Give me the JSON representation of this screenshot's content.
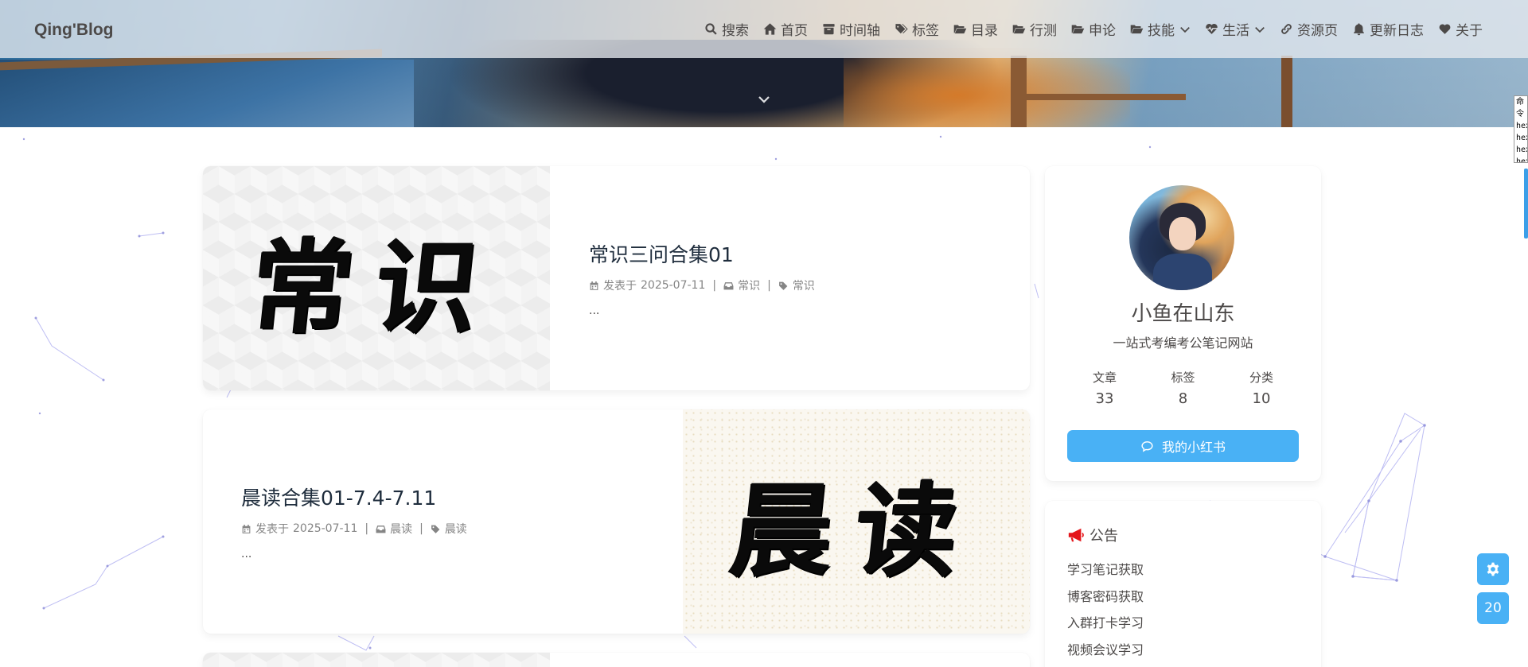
{
  "brand": "Qing'Blog",
  "nav": [
    {
      "label": "搜索",
      "icon": "search-icon"
    },
    {
      "label": "首页",
      "icon": "home-icon"
    },
    {
      "label": "时间轴",
      "icon": "archive-icon"
    },
    {
      "label": "标签",
      "icon": "tags-icon"
    },
    {
      "label": "目录",
      "icon": "folder-open-icon"
    },
    {
      "label": "行测",
      "icon": "folder-open-icon"
    },
    {
      "label": "申论",
      "icon": "folder-open-icon"
    },
    {
      "label": "技能",
      "icon": "folder-open-icon",
      "dropdown": true
    },
    {
      "label": "生活",
      "icon": "heartbeat-icon",
      "dropdown": true
    },
    {
      "label": "资源页",
      "icon": "link-icon"
    },
    {
      "label": "更新日志",
      "icon": "bell-icon"
    },
    {
      "label": "关于",
      "icon": "heart-icon"
    }
  ],
  "edge_tooltip": [
    "命令",
    "hex",
    "hex",
    "hex",
    "hex"
  ],
  "posts": [
    {
      "cover_text": "常识",
      "title": "常识三问合集01",
      "date_prefix": "发表于",
      "date": "2025-07-11",
      "category": "常识",
      "tag": "常识",
      "excerpt": "..."
    },
    {
      "cover_text": "晨读",
      "title": "晨读合集01-7.4-7.11",
      "date_prefix": "发表于",
      "date": "2025-07-11",
      "category": "晨读",
      "tag": "晨读",
      "excerpt": "..."
    }
  ],
  "author": {
    "name": "小鱼在山东",
    "description": "一站式考编考公笔记网站",
    "stats": [
      {
        "label": "文章",
        "value": "33"
      },
      {
        "label": "标签",
        "value": "8"
      },
      {
        "label": "分类",
        "value": "10"
      }
    ],
    "button_label": "我的小红书"
  },
  "notice": {
    "title": "公告",
    "items": [
      "学习笔记获取",
      "博客密码获取",
      "入群打卡学习",
      "视频会议学习"
    ]
  },
  "float": {
    "settings_icon": "gear-icon",
    "progress": "20"
  },
  "colors": {
    "accent": "#49b1f5",
    "text": "#4c4948",
    "meta": "#858585"
  }
}
